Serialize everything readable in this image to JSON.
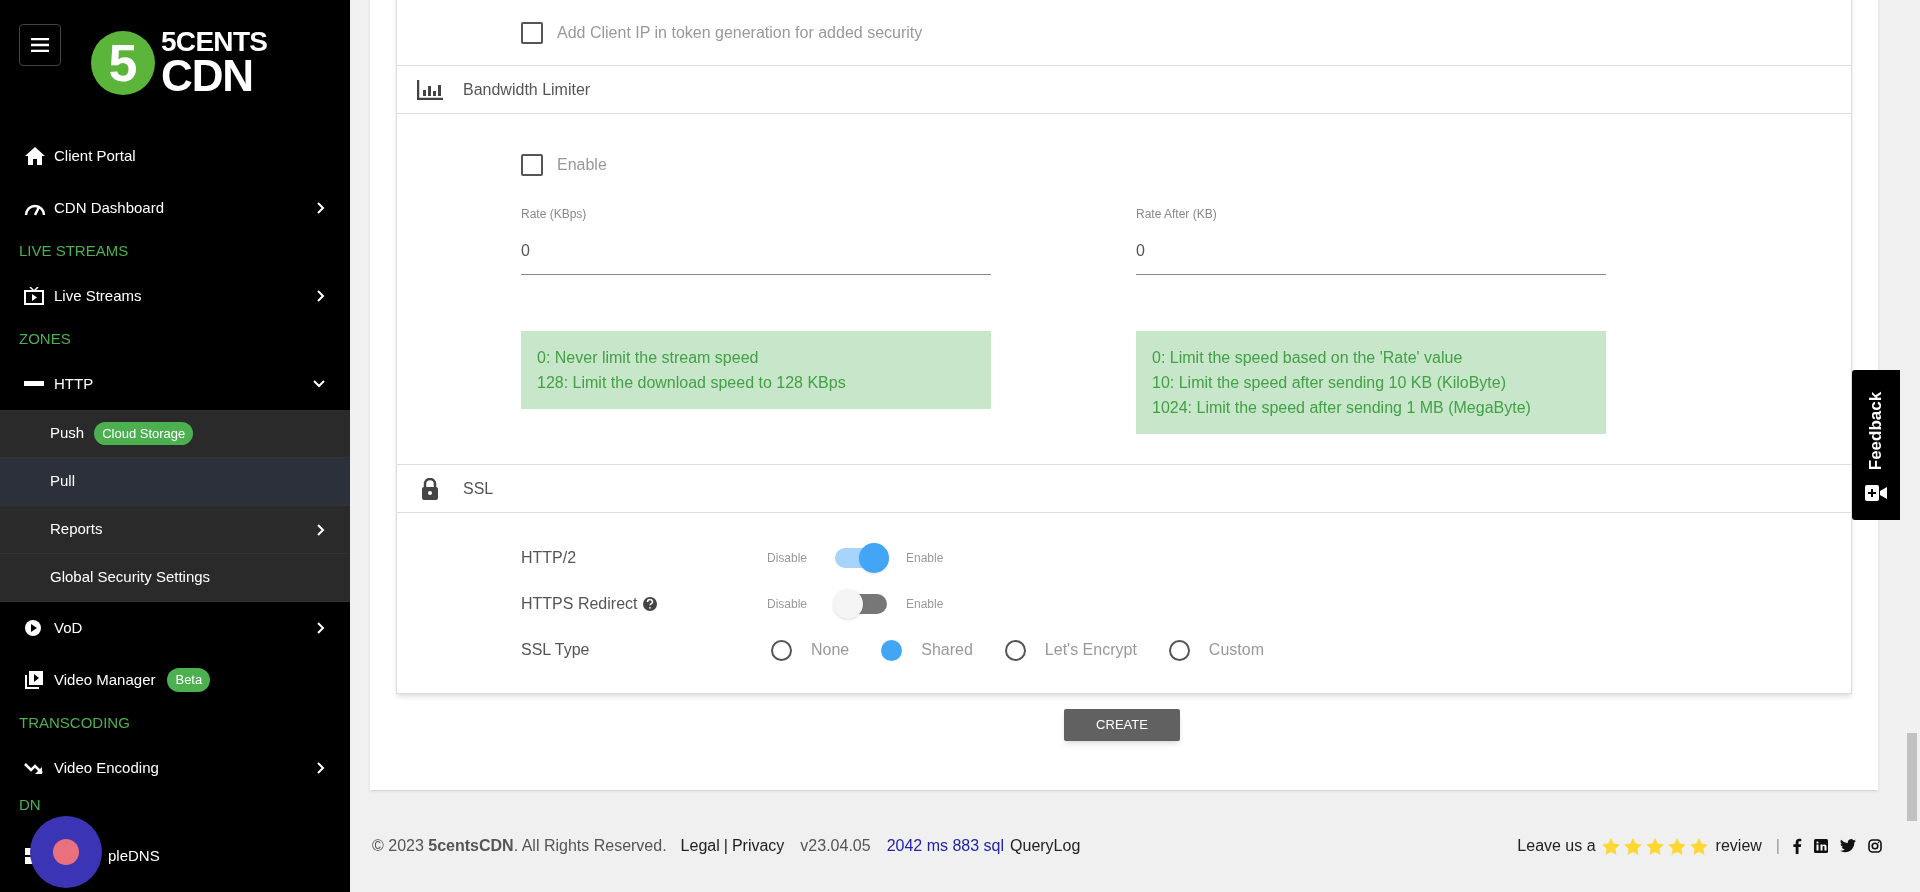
{
  "sidebar": {
    "logo": {
      "digit": "5",
      "line1": "5CENTS",
      "line2": "CDN"
    },
    "items": [
      {
        "kind": "link",
        "label": "Client Portal"
      },
      {
        "kind": "link",
        "label": "CDN Dashboard",
        "expanded": false
      },
      {
        "kind": "header",
        "label": "LIVE STREAMS"
      },
      {
        "kind": "link",
        "label": "Live Streams",
        "expanded": false
      },
      {
        "kind": "header",
        "label": "ZONES"
      },
      {
        "kind": "link",
        "label": "HTTP",
        "expanded": true,
        "children": [
          {
            "label": "Push",
            "badge": "Cloud Storage",
            "selected": false
          },
          {
            "label": "Pull",
            "selected": true
          },
          {
            "label": "Reports",
            "expanded": false,
            "selected": false
          },
          {
            "label": "Global Security Settings",
            "selected": false
          }
        ]
      },
      {
        "kind": "link",
        "label": "VoD",
        "expanded": false
      },
      {
        "kind": "link",
        "label": "Video Manager",
        "badge": "Beta"
      },
      {
        "kind": "header",
        "label": "TRANSCODING"
      },
      {
        "kind": "link",
        "label": "Video Encoding",
        "expanded": false
      },
      {
        "kind": "header",
        "label": "DN"
      },
      {
        "kind": "link",
        "label": "pleDNS"
      }
    ]
  },
  "security": {
    "label": "Add Client IP in token generation for added security",
    "checked": false
  },
  "bandwidth": {
    "title": "Bandwidth Limiter",
    "enable": {
      "label": "Enable",
      "checked": false
    },
    "fields": [
      {
        "label": "Rate (KBps)",
        "value": "0",
        "help": [
          "0: Never limit the stream speed",
          "128: Limit the download speed to 128 KBps"
        ]
      },
      {
        "label": "Rate After (KB)",
        "value": "0",
        "help": [
          "0: Limit the speed based on the 'Rate' value",
          "10: Limit the speed after sending 10 KB (KiloByte)",
          "1024: Limit the speed after sending 1 MB (MegaByte)"
        ]
      }
    ]
  },
  "ssl": {
    "title": "SSL",
    "toggles": [
      {
        "label": "HTTP/2",
        "off_label": "Disable",
        "on_label": "Enable",
        "on": true,
        "help_icon": false
      },
      {
        "label": "HTTPS Redirect",
        "off_label": "Disable",
        "on_label": "Enable",
        "on": false,
        "help_icon": true
      }
    ],
    "ssl_type": {
      "label": "SSL Type",
      "options": [
        {
          "label": "None",
          "selected": false
        },
        {
          "label": "Shared",
          "selected": true
        },
        {
          "label": "Let's Encrypt",
          "selected": false
        },
        {
          "label": "Custom",
          "selected": false
        }
      ]
    }
  },
  "create_button": "CREATE",
  "feedback": "Feedback",
  "footer": {
    "copyright": "© 2023 **5centsCDN**. All Rights Reserved.",
    "legal": "Legal",
    "separator": "|",
    "privacy": "Privacy",
    "version": "v23.04.05",
    "timing": "2042 ms 883 sql",
    "querylog": "QueryLog",
    "review_prefix": "Leave us a",
    "stars": 5,
    "review_suffix": "review",
    "divider": "|"
  }
}
